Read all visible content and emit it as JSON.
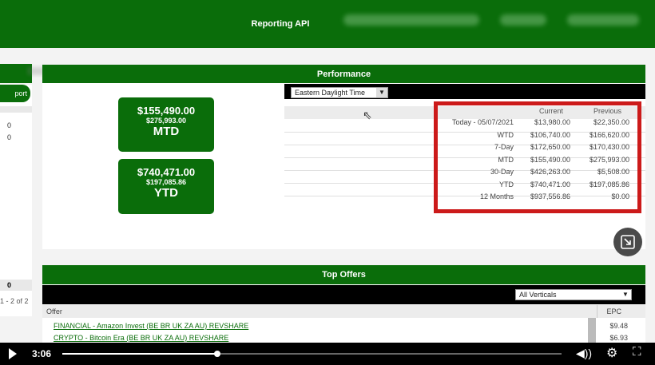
{
  "header": {
    "link_label": "Reporting API",
    "blurred_items": 3
  },
  "left_panel": {
    "button_label": "port",
    "rows": [
      "0",
      "0"
    ],
    "total": "0",
    "pagination": "1 - 2 of 2"
  },
  "performance": {
    "title": "Performance",
    "cards": [
      {
        "value": "$155,490.00",
        "previous": "$275,993.00",
        "label": "MTD"
      },
      {
        "value": "$740,471.00",
        "previous": "$197,085.86",
        "label": "YTD"
      }
    ],
    "timezone_select": "Eastern Daylight Time",
    "table": {
      "headers": [
        "",
        "Current",
        "Previous"
      ],
      "rows": [
        [
          "Today - 05/07/2021",
          "$13,980.00",
          "$22,350.00"
        ],
        [
          "WTD",
          "$106,740.00",
          "$166,620.00"
        ],
        [
          "7-Day",
          "$172,650.00",
          "$170,430.00"
        ],
        [
          "MTD",
          "$155,490.00",
          "$275,993.00"
        ],
        [
          "30-Day",
          "$426,263.00",
          "$5,508.00"
        ],
        [
          "YTD",
          "$740,471.00",
          "$197,085.86"
        ],
        [
          "12 Months",
          "$937,556.86",
          "$0.00"
        ]
      ]
    }
  },
  "top_offers": {
    "title": "Top Offers",
    "vertical_select": "All Verticals",
    "columns": [
      "Offer",
      "EPC"
    ],
    "rows": [
      {
        "offer": "FINANCIAL - Amazon Invest (BE BR UK ZA AU) REVSHARE",
        "epc": "$9.48"
      },
      {
        "offer": "CRYPTO - Bitcoin Era (BE BR UK ZA AU) REVSHARE",
        "epc": "$6.93"
      }
    ]
  },
  "player": {
    "time": "3:06",
    "progress": 0.31
  }
}
